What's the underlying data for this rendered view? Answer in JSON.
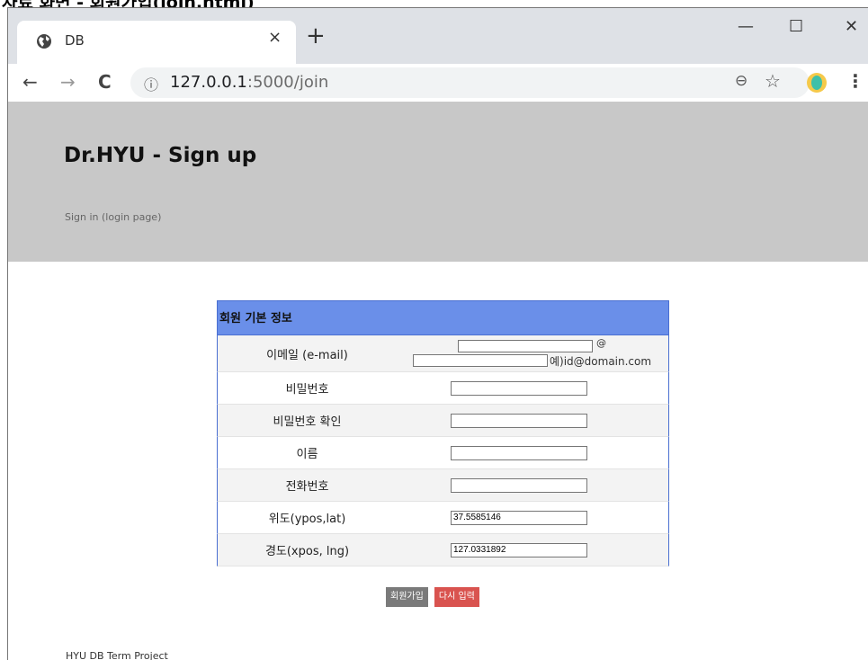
{
  "doc_heading": "자료 화면 - 회원가입(join.html)",
  "browser": {
    "tab_title": "DB",
    "tab_close": "×",
    "new_tab": "+",
    "minimize": "—",
    "maximize": "☐",
    "close": "✕",
    "back": "←",
    "forward": "→",
    "reload": "C",
    "url_host": "127.0.0.1",
    "url_path": ":5000/join",
    "zoom_icon": "⊖",
    "star_icon": "☆",
    "menu_icon": "⋮"
  },
  "banner": {
    "title": "Dr.HYU - Sign up",
    "signin_link": "Sign in (login page)"
  },
  "form": {
    "header": "회원 기본 정보",
    "email_label": "이메일 (e-mail)",
    "email_at": "@",
    "email_example": "예)id@domain.com",
    "rows": [
      {
        "label": "비밀번호",
        "value": ""
      },
      {
        "label": "비밀번호 확인",
        "value": ""
      },
      {
        "label": "이름",
        "value": ""
      },
      {
        "label": "전화번호",
        "value": ""
      },
      {
        "label": "위도(ypos,lat)",
        "value": "37.5585146"
      },
      {
        "label": "경도(xpos, lng)",
        "value": "127.0331892"
      }
    ],
    "submit_label": "회원가입",
    "reset_label": "다시 입력"
  },
  "footer": "HYU DB Term Project"
}
